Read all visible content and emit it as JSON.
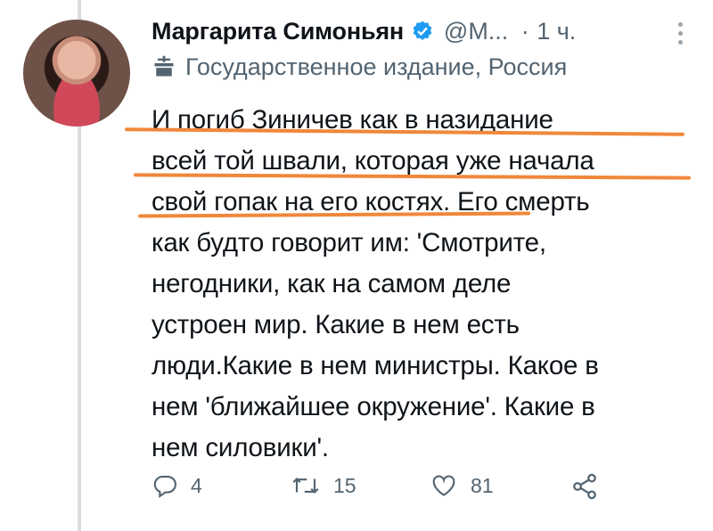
{
  "tweet": {
    "author_name": "Маргарита Симоньян",
    "handle": "@M...",
    "separator": "·",
    "time": "1 ч.",
    "label": "Государственное издание, Россия",
    "text_lines": [
      "И погиб Зиничев как в назидание",
      "всей той швали, которая уже начала",
      "свой гопак на его костях. Его смерть",
      "как будто говорит им: 'Смотрите,",
      "негодники, как на самом деле",
      "устроен мир. Какие в нем есть",
      "люди.Какие в нем министры. Какое в",
      "нем 'ближайшее окружение'. Какие в",
      "нем силовики'."
    ]
  },
  "actions": {
    "reply_count": "4",
    "retweet_count": "15",
    "like_count": "81"
  },
  "icons": [
    "verified-badge-icon",
    "more-icon",
    "state-media-icon",
    "reply-icon",
    "retweet-icon",
    "like-icon",
    "share-icon"
  ],
  "colors": {
    "verified": "#1d9bf0",
    "highlight": "#f0873a",
    "secondary_text": "#536471"
  }
}
